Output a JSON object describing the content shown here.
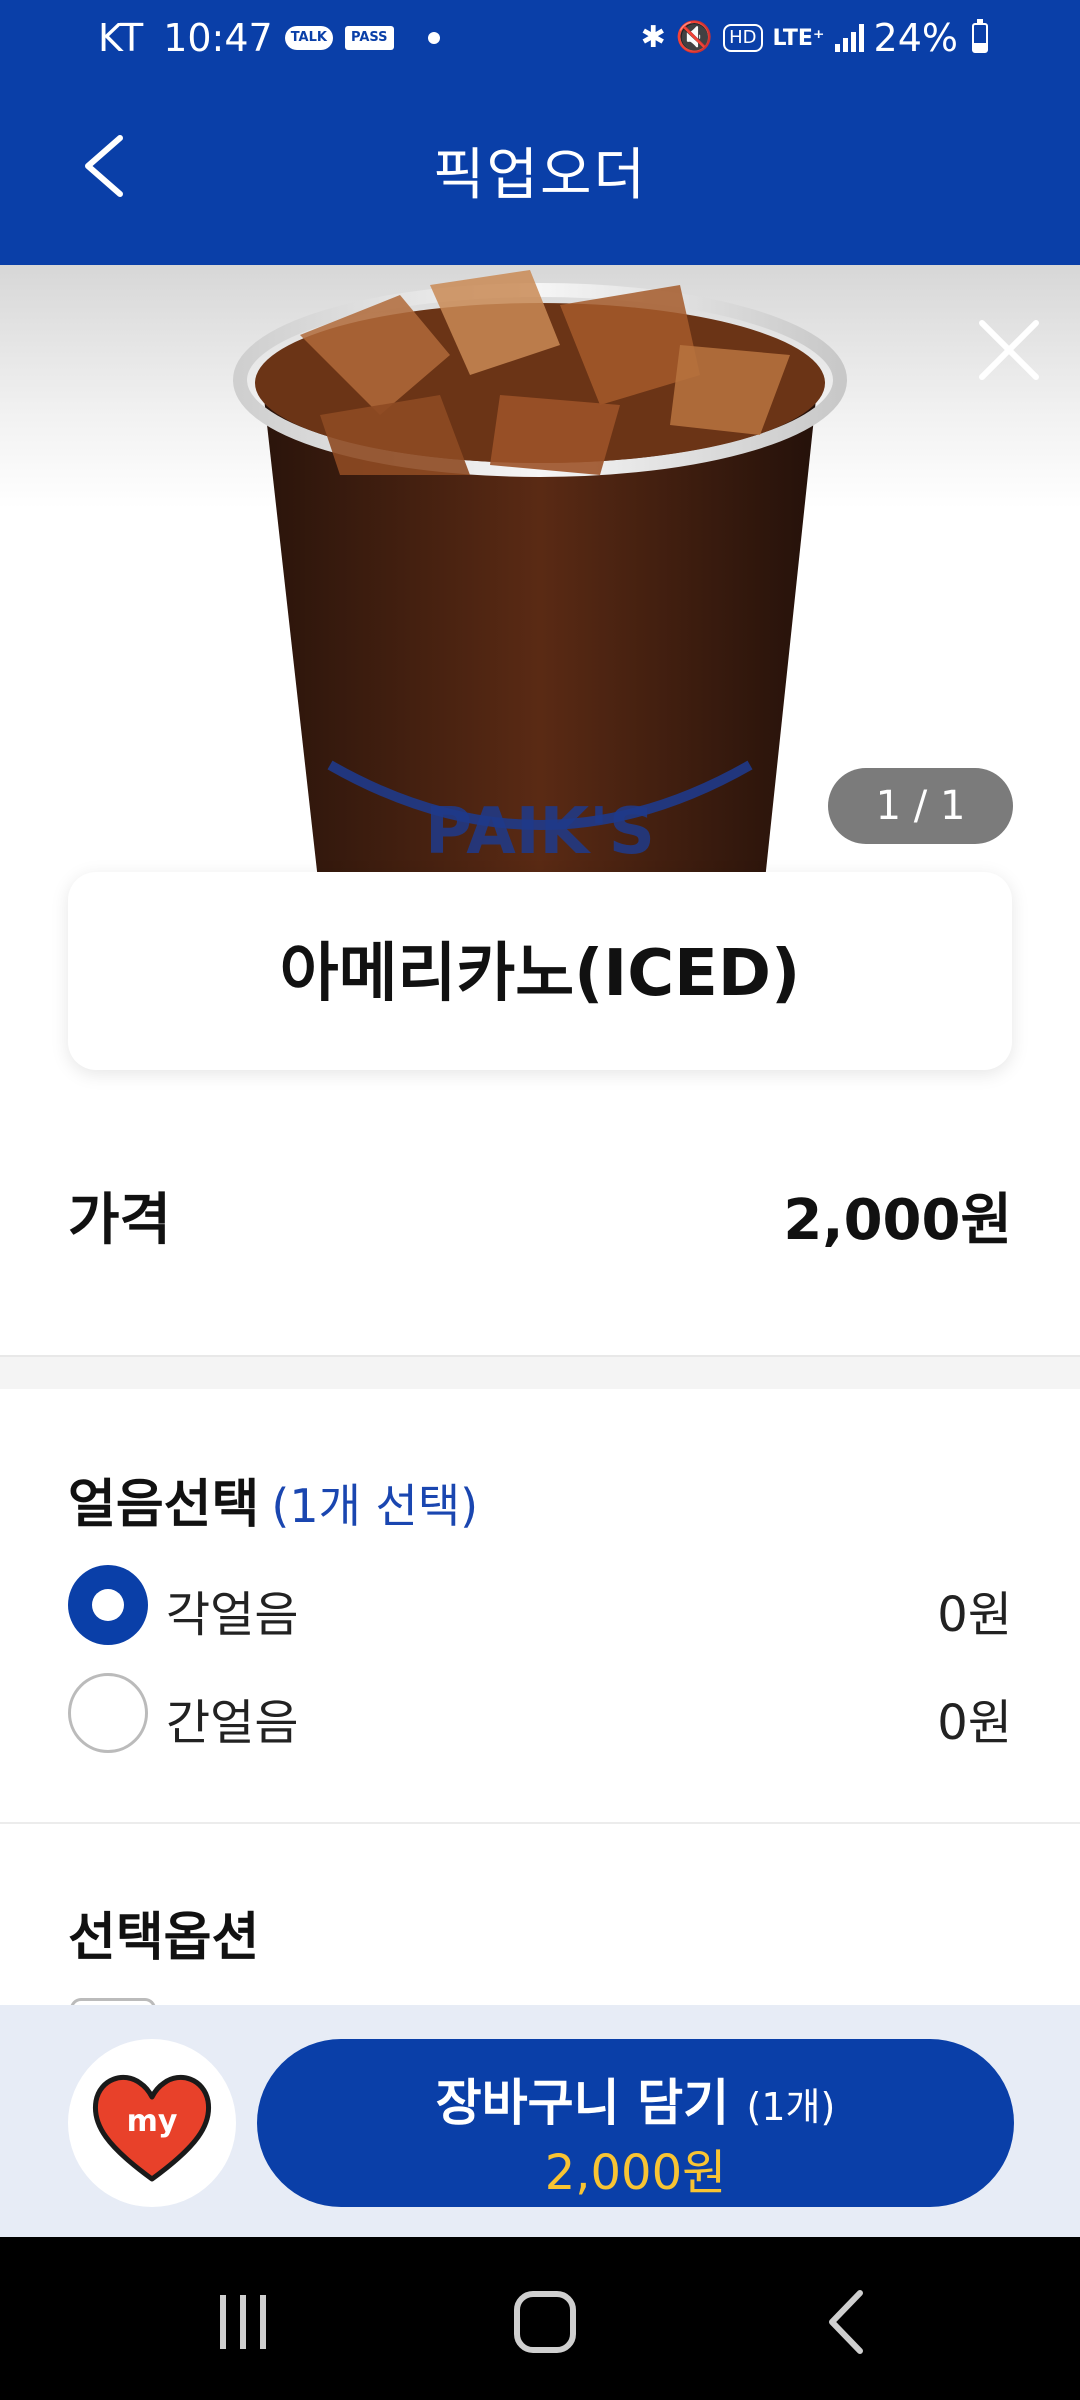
{
  "status_bar": {
    "carrier": "KT",
    "time": "10:47",
    "talk_label": "TALK",
    "pass_label": "PASS",
    "hd_label": "HD",
    "lte_label": "LTE⁺",
    "battery": "24%"
  },
  "header": {
    "title": "픽업오더"
  },
  "image_counter": "1 / 1",
  "product": {
    "name": "아메리카노(ICED)",
    "price_label": "가격",
    "price_value": "2,000원"
  },
  "ice_section": {
    "title": "얼음선택",
    "subtitle": "(1개 선택)",
    "options": [
      {
        "label": "각얼음",
        "price": "0원",
        "selected": true
      },
      {
        "label": "간얼음",
        "price": "0원",
        "selected": false
      }
    ]
  },
  "options_section": {
    "title": "선택옵션"
  },
  "bottom": {
    "my_label": "my",
    "cart_label": "장바구니 담기",
    "cart_count": "(1개)",
    "cart_price": "2,000원"
  },
  "colors": {
    "brand": "#0a3fa8",
    "price_accent": "#f8c433",
    "subtitle": "#1a46b0"
  }
}
